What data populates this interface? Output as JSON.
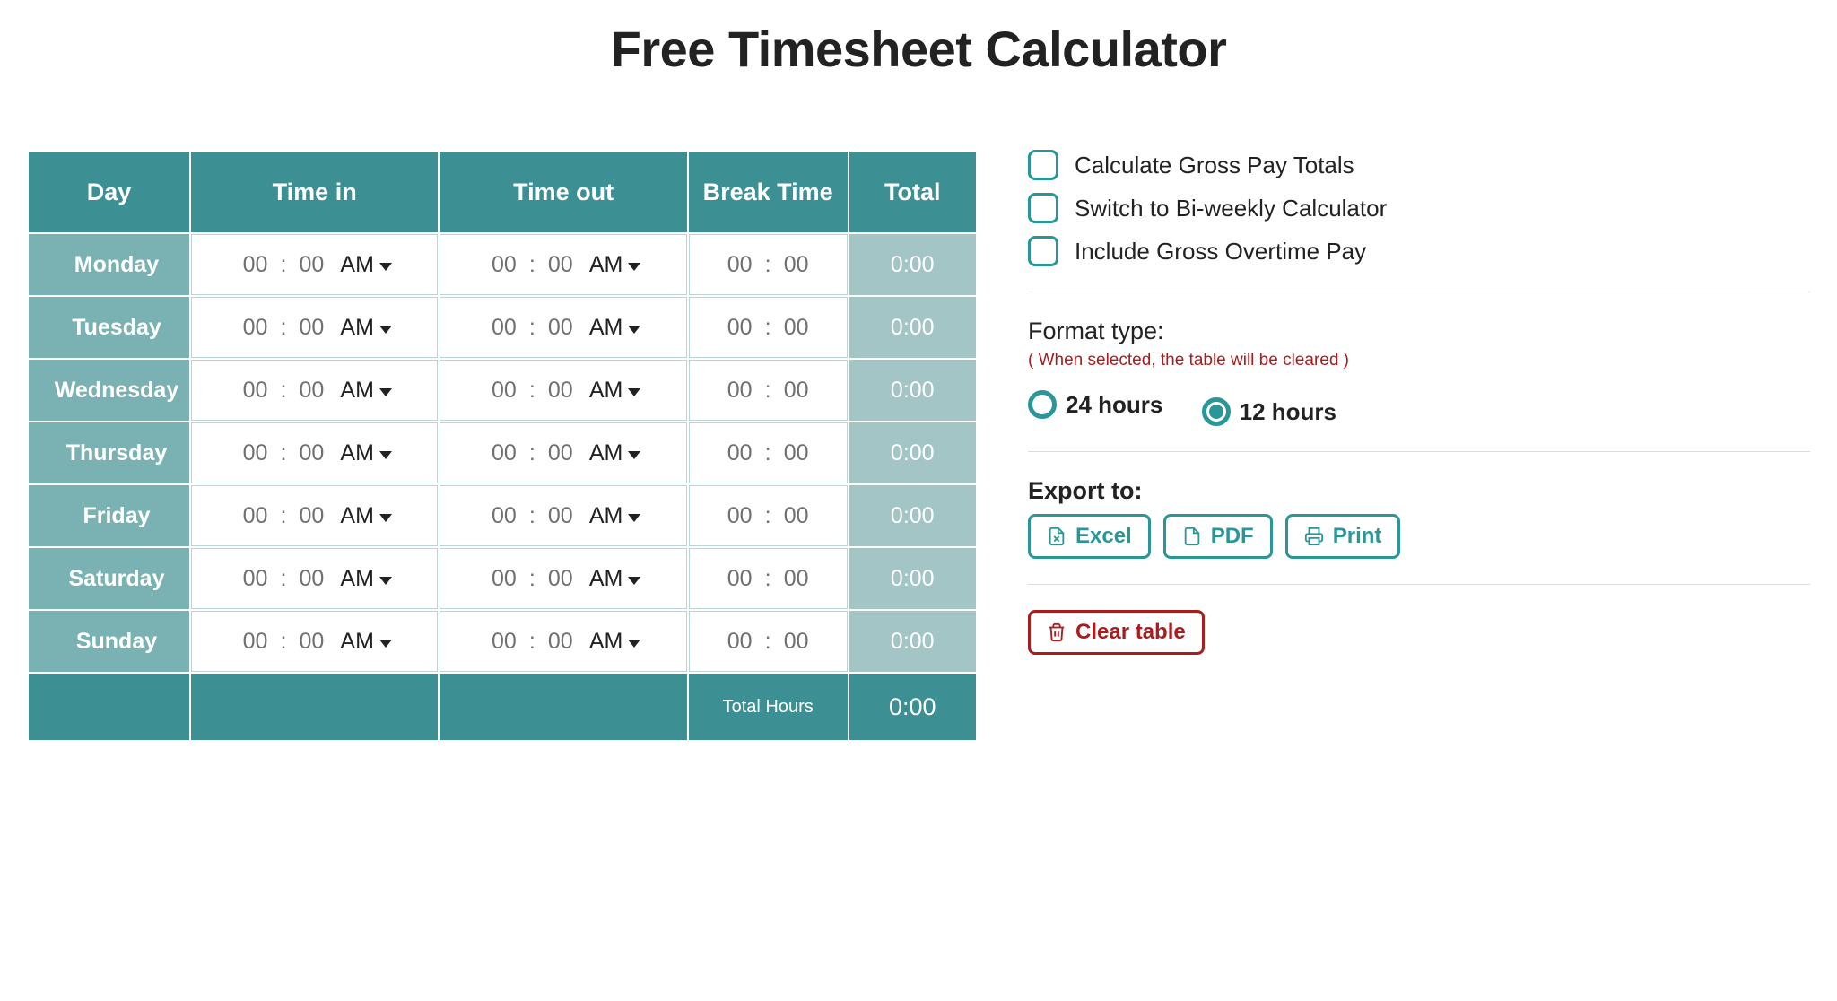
{
  "page_title": "Free Timesheet Calculator",
  "headers": {
    "day": "Day",
    "time_in": "Time in",
    "time_out": "Time out",
    "break": "Break Time",
    "total": "Total"
  },
  "days": [
    {
      "name": "Monday",
      "in_hh": "00",
      "in_mm": "00",
      "in_ampm": "AM",
      "out_hh": "00",
      "out_mm": "00",
      "out_ampm": "AM",
      "br_hh": "00",
      "br_mm": "00",
      "total": "0:00"
    },
    {
      "name": "Tuesday",
      "in_hh": "00",
      "in_mm": "00",
      "in_ampm": "AM",
      "out_hh": "00",
      "out_mm": "00",
      "out_ampm": "AM",
      "br_hh": "00",
      "br_mm": "00",
      "total": "0:00"
    },
    {
      "name": "Wednesday",
      "in_hh": "00",
      "in_mm": "00",
      "in_ampm": "AM",
      "out_hh": "00",
      "out_mm": "00",
      "out_ampm": "AM",
      "br_hh": "00",
      "br_mm": "00",
      "total": "0:00"
    },
    {
      "name": "Thursday",
      "in_hh": "00",
      "in_mm": "00",
      "in_ampm": "AM",
      "out_hh": "00",
      "out_mm": "00",
      "out_ampm": "AM",
      "br_hh": "00",
      "br_mm": "00",
      "total": "0:00"
    },
    {
      "name": "Friday",
      "in_hh": "00",
      "in_mm": "00",
      "in_ampm": "AM",
      "out_hh": "00",
      "out_mm": "00",
      "out_ampm": "AM",
      "br_hh": "00",
      "br_mm": "00",
      "total": "0:00"
    },
    {
      "name": "Saturday",
      "in_hh": "00",
      "in_mm": "00",
      "in_ampm": "AM",
      "out_hh": "00",
      "out_mm": "00",
      "out_ampm": "AM",
      "br_hh": "00",
      "br_mm": "00",
      "total": "0:00"
    },
    {
      "name": "Sunday",
      "in_hh": "00",
      "in_mm": "00",
      "in_ampm": "AM",
      "out_hh": "00",
      "out_mm": "00",
      "out_ampm": "AM",
      "br_hh": "00",
      "br_mm": "00",
      "total": "0:00"
    }
  ],
  "footer": {
    "total_hours_label": "Total Hours",
    "total_hours_value": "0:00"
  },
  "options": {
    "gross_pay": {
      "label": "Calculate Gross Pay Totals",
      "checked": false
    },
    "biweekly": {
      "label": "Switch to Bi-weekly Calculator",
      "checked": false
    },
    "overtime": {
      "label": "Include Gross Overtime Pay",
      "checked": false
    }
  },
  "format": {
    "label": "Format type:",
    "hint": "( When selected, the table will be cleared )",
    "choices": {
      "h24": {
        "label": "24 hours",
        "selected": false
      },
      "h12": {
        "label": "12 hours",
        "selected": true
      }
    }
  },
  "export": {
    "label": "Export to:",
    "excel": "Excel",
    "pdf": "PDF",
    "print": "Print"
  },
  "clear_label": "Clear table"
}
